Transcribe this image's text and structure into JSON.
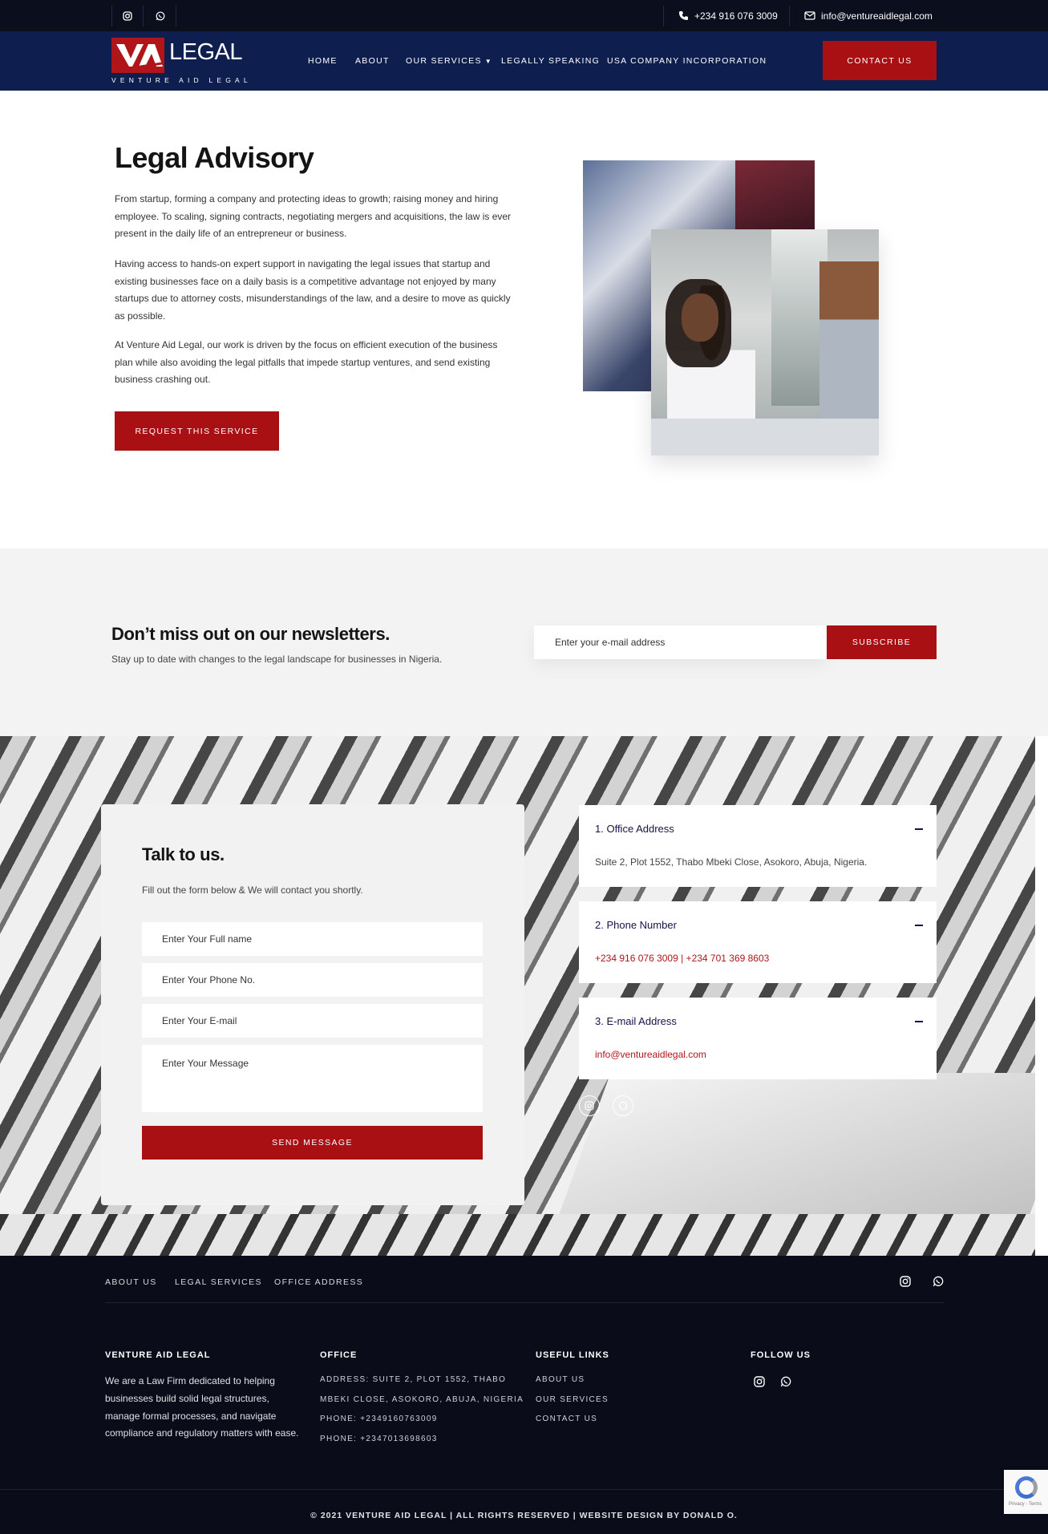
{
  "topbar": {
    "phone": "+234 916 076 3009",
    "email": "info@ventureaidlegal.com",
    "icons": [
      "instagram-icon",
      "whatsapp-icon",
      "phone-icon",
      "mail-icon"
    ]
  },
  "brand": {
    "mark": "VA",
    "word": "LEGAL",
    "tagline": "VENTURE AID LEGAL",
    "colors": {
      "navy": "#0e1f4f",
      "red": "#a81014",
      "dark": "#0b0c1a"
    }
  },
  "nav": {
    "items": [
      "HOME",
      "ABOUT",
      "OUR SERVICES",
      "LEGALLY SPEAKING",
      "USA COMPANY INCORPORATION"
    ],
    "cta": "CONTACT US"
  },
  "hero": {
    "title": "Legal Advisory",
    "paragraphs": [
      "From startup, forming a company and protecting ideas to growth; raising money and hiring employee. To scaling, signing contracts, negotiating mergers and acquisitions, the law is ever present in the daily life of an entrepreneur or business.",
      "Having access to hands-on expert support in navigating the legal issues that startup and existing businesses face on a daily basis is a competitive advantage not enjoyed by many startups due to attorney costs, misunderstandings of the law, and a desire to move as quickly as possible.",
      "At Venture Aid Legal, our work is driven by the focus on efficient execution of the business plan while also avoiding the legal pitfalls that impede startup ventures, and send existing business crashing out."
    ],
    "button": "REQUEST THIS SERVICE"
  },
  "newsletter": {
    "title": "Don’t miss out on our newsletters.",
    "subtitle": "Stay up to date with changes to the legal landscape for businesses in Nigeria.",
    "placeholder": "Enter your e-mail address",
    "button": "SUBSCRIBE"
  },
  "contact": {
    "title": "Talk to us.",
    "lead": "Fill out the form below & We will contact you shortly.",
    "fields": [
      "Enter Your Full name",
      "Enter Your Phone No.",
      "Enter Your E-mail",
      "Enter Your Message"
    ],
    "button": "SEND MESSAGE",
    "accordion": [
      {
        "title": "1. Office Address",
        "value": "Suite 2, Plot 1552, Thabo Mbeki Close, Asokoro, Abuja, Nigeria."
      },
      {
        "title": "2. Phone Number",
        "value": "+234 916 076 3009 | +234 701 369 8603"
      },
      {
        "title": "3. E-mail Address",
        "value": "info@ventureaidlegal.com"
      }
    ]
  },
  "footer": {
    "top_links": [
      "ABOUT US",
      "LEGAL SERVICES",
      "OFFICE ADDRESS"
    ],
    "col1": {
      "heading": "VENTURE AID LEGAL",
      "text": "We are a Law Firm dedicated to helping businesses build solid legal structures, manage formal processes, and navigate compliance and regulatory matters with ease."
    },
    "col2": {
      "heading": "OFFICE",
      "lines": [
        "ADDRESS: SUITE 2, PLOT 1552, THABO",
        "MBEKI CLOSE, ASOKORO, ABUJA, NIGERIA",
        "PHONE: +2349160763009",
        "PHONE: +2347013698603"
      ]
    },
    "col3": {
      "heading": "USEFUL LINKS",
      "lines": [
        "ABOUT US",
        "OUR SERVICES",
        "CONTACT US"
      ]
    },
    "col4": {
      "heading": "FOLLOW US"
    },
    "copyright": "© 2021 VENTURE AID LEGAL | ALL RIGHTS RESERVED | WEBSITE DESIGN BY DONALD O.",
    "recaptcha": "Privacy - Terms"
  }
}
